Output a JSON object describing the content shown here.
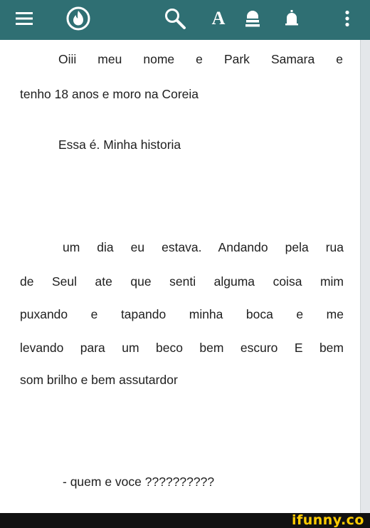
{
  "toolbar": {
    "font_label": "A",
    "more_label": "⋮"
  },
  "story": {
    "p1_line1": "Oiii meu nome e Park Samara e",
    "p1_line2": "tenho 18 anos e moro na Coreia",
    "p2_line1": "Essa é. Minha historia",
    "p3_line1": "um dia eu estava. Andando pela rua",
    "p3_line2": "de Seul ate que senti alguma coisa mim",
    "p3_line3": "puxando e tapando minha boca e me",
    "p3_line4": "levando para um beco bem escuro E bem",
    "p3_line5": "som brilho e bem assutardor",
    "p4_line1": "- quem e voce ??????????"
  },
  "watermark": {
    "text": "ifunny.co"
  },
  "colors": {
    "topbar": "#2f6f73",
    "text": "#1e1e1e",
    "watermark": "#ffcc00"
  }
}
